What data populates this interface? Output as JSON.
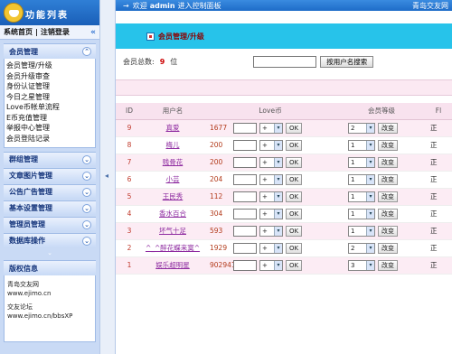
{
  "sidebar": {
    "title": "功能列表",
    "top_links": {
      "home": "系统首页",
      "sep": "|",
      "logout": "注销登录",
      "collapse_icon": "«"
    },
    "active_group": {
      "title": "会员管理",
      "items": [
        "会员管理/升级",
        "会员升级审查",
        "身份认证管理",
        "今日之星管理",
        "Love币帐单流程",
        "E币充值管理",
        "举报中心管理",
        "会员登陆记录"
      ]
    },
    "groups": [
      "群组管理",
      "文章图片管理",
      "公告广告管理",
      "基本设置管理",
      "管理员管理",
      "数据库操作"
    ],
    "info": {
      "title": "版权信息",
      "lines": [
        "青岛交友网",
        "www.ejimo.cn",
        "交友论坛",
        "www.ejimo.cn/bbsXP"
      ]
    }
  },
  "topbar": {
    "welcome": "欢迎",
    "username": "admin",
    "enter": "进入控制面板",
    "site": "青岛交友网"
  },
  "main": {
    "page_title": "会员管理/升级",
    "count_label": "会员总数:",
    "count_value": "9",
    "count_unit": "位",
    "search_button": "按用户名搜索",
    "columns": [
      "ID",
      "用户名",
      "Love币",
      "会员等级",
      "Fl"
    ],
    "rows": [
      {
        "id": "9",
        "name": "真爱",
        "love": "1677",
        "op": "+",
        "level": "2",
        "status": "正"
      },
      {
        "id": "8",
        "name": "梅儿",
        "love": "200",
        "op": "+",
        "level": "1",
        "status": "正"
      },
      {
        "id": "7",
        "name": "贱骨花",
        "love": "200",
        "op": "+",
        "level": "1",
        "status": "正"
      },
      {
        "id": "6",
        "name": "小芸",
        "love": "204",
        "op": "+",
        "level": "1",
        "status": "正"
      },
      {
        "id": "5",
        "name": "王民秀",
        "love": "112",
        "op": "+",
        "level": "1",
        "status": "正"
      },
      {
        "id": "4",
        "name": "香水百合",
        "love": "304",
        "op": "+",
        "level": "1",
        "status": "正"
      },
      {
        "id": "3",
        "name": "坏气十足",
        "love": "593",
        "op": "+",
        "level": "1",
        "status": "正"
      },
      {
        "id": "2",
        "name": "^_^醉花蝶来寞^",
        "love": "1929",
        "op": "+",
        "level": "2",
        "status": "正"
      },
      {
        "id": "1",
        "name": "娱乐超明星",
        "love": "902941",
        "op": "+",
        "level": "3",
        "status": "正"
      }
    ],
    "ok_label": "OK",
    "change_label": "改变"
  }
}
